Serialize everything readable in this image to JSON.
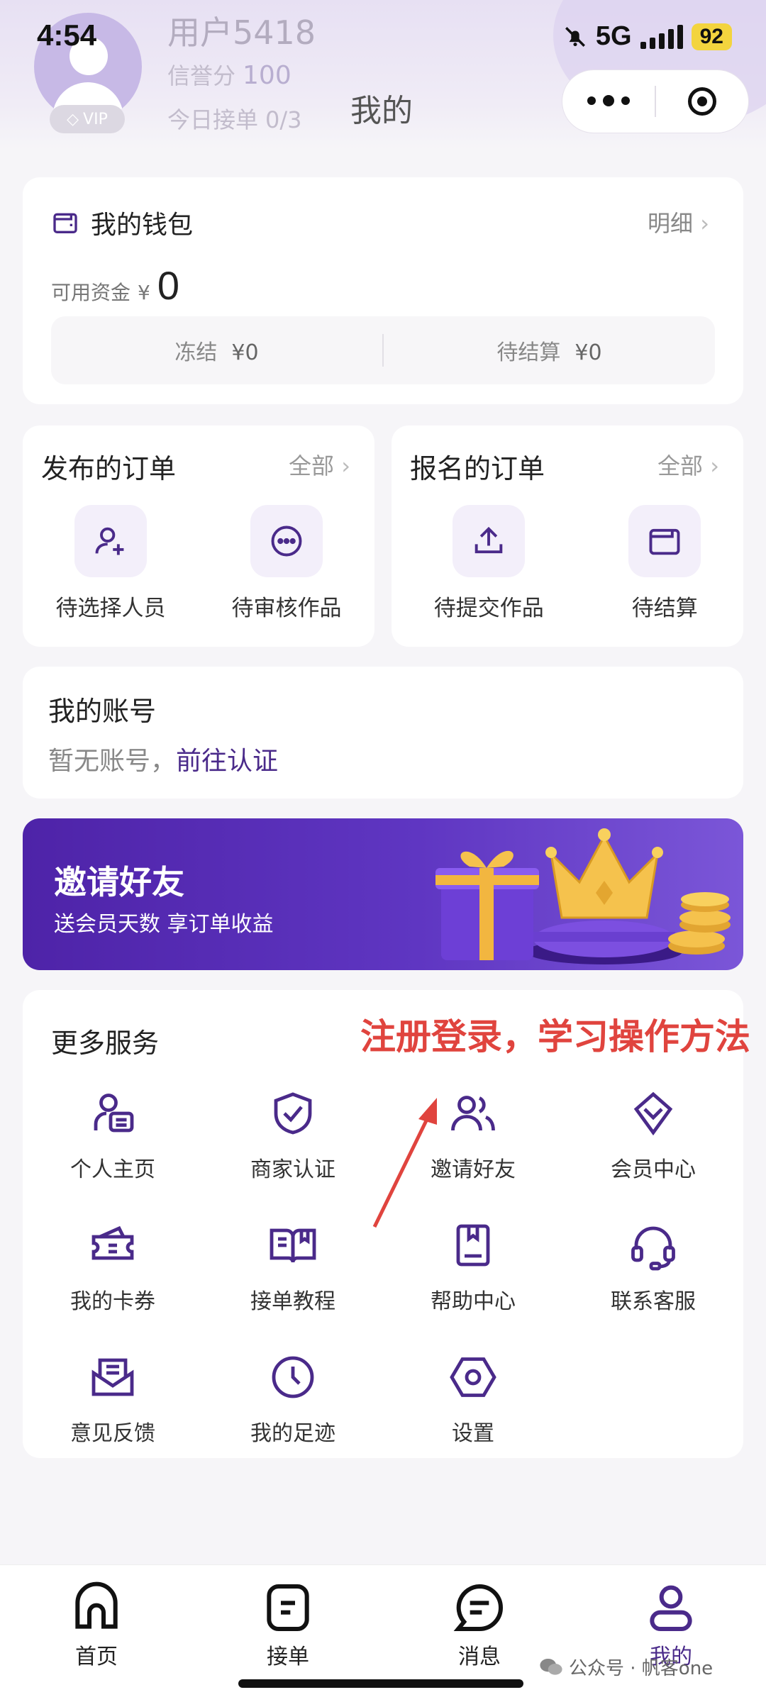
{
  "status_bar": {
    "time": "4:54",
    "network": "5G",
    "battery": "92"
  },
  "profile": {
    "username": "用户5418",
    "credit_label": "信誉分",
    "credit_value": "100",
    "today_label": "今日接单",
    "today_value": "0/3",
    "vip_badge": "VIP"
  },
  "nav": {
    "title": "我的"
  },
  "wallet": {
    "title": "我的钱包",
    "detail_link": "明细",
    "available_label": "可用资金",
    "currency": "¥",
    "available_value": "0",
    "frozen_label": "冻结",
    "frozen_value": "¥0",
    "pending_label": "待结算",
    "pending_value": "¥0"
  },
  "published_orders": {
    "title": "发布的订单",
    "all_link": "全部",
    "items": [
      {
        "label": "待选择人员",
        "icon": "add-user-icon"
      },
      {
        "label": "待审核作品",
        "icon": "more-circle-icon"
      }
    ]
  },
  "applied_orders": {
    "title": "报名的订单",
    "all_link": "全部",
    "items": [
      {
        "label": "待提交作品",
        "icon": "upload-icon"
      },
      {
        "label": "待结算",
        "icon": "wallet-icon"
      }
    ]
  },
  "account": {
    "title": "我的账号",
    "status": "暂无账号，",
    "action_link": "前往认证"
  },
  "invite_banner": {
    "title": "邀请好友",
    "subtitle": "送会员天数 享订单收益"
  },
  "services": {
    "title": "更多服务",
    "items": [
      {
        "label": "个人主页",
        "icon": "profile-card-icon"
      },
      {
        "label": "商家认证",
        "icon": "shield-check-icon"
      },
      {
        "label": "邀请好友",
        "icon": "users-icon"
      },
      {
        "label": "会员中心",
        "icon": "diamond-icon"
      },
      {
        "label": "我的卡券",
        "icon": "coupon-icon"
      },
      {
        "label": "接单教程",
        "icon": "book-icon"
      },
      {
        "label": "帮助中心",
        "icon": "help-book-icon"
      },
      {
        "label": "联系客服",
        "icon": "headset-icon"
      },
      {
        "label": "意见反馈",
        "icon": "mail-icon"
      },
      {
        "label": "我的足迹",
        "icon": "clock-icon"
      },
      {
        "label": "设置",
        "icon": "settings-hex-icon"
      }
    ]
  },
  "annotation": {
    "text": "注册登录，学习操作方法"
  },
  "tabbar": {
    "items": [
      {
        "label": "首页",
        "icon": "home-icon"
      },
      {
        "label": "接单",
        "icon": "document-icon"
      },
      {
        "label": "消息",
        "icon": "chat-icon"
      },
      {
        "label": "我的",
        "icon": "user-icon"
      }
    ],
    "active": "我的"
  },
  "watermark": {
    "text": "公众号 · 帆客one"
  },
  "colors": {
    "brand": "#4a2a8a",
    "annotation": "#e0443e",
    "banner": "#5f36c2"
  }
}
